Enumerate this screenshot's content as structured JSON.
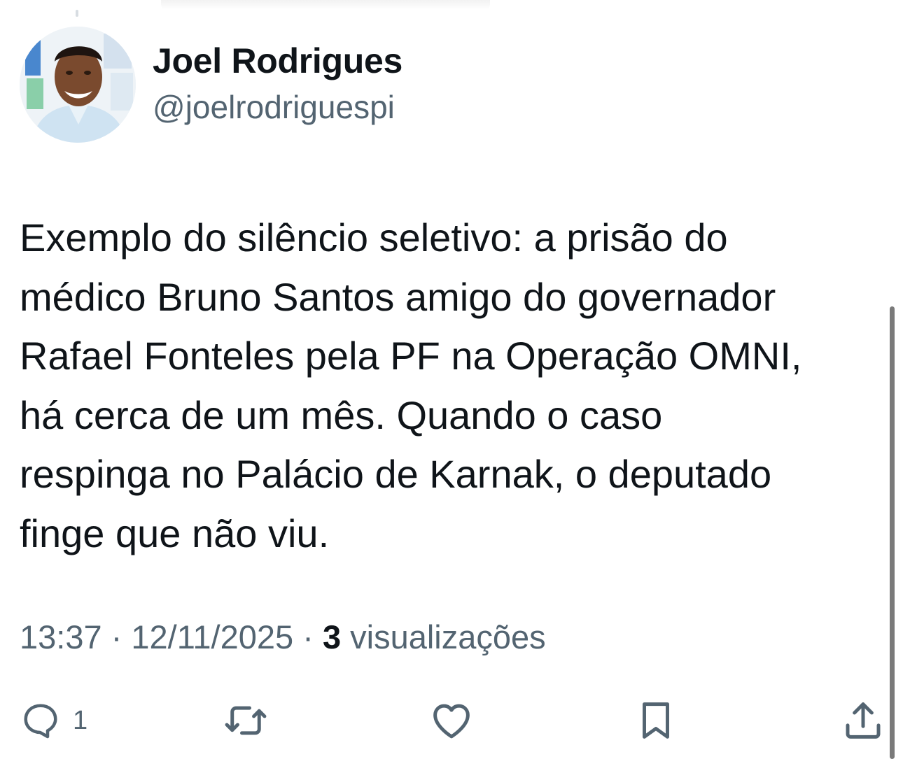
{
  "author": {
    "name": "Joel Rodrigues",
    "handle": "@joelrodriguespi"
  },
  "tweet": {
    "text": "Exemplo do silêncio seletivo: a prisão do\nmédico Bruno Santos amigo do governador\nRafael Fonteles pela PF na Operação OMNI,\nhá cerca de um mês. Quando o caso\nrespinga no Palácio de Karnak, o deputado\nfinge que não viu.",
    "time": "13:37",
    "separator": " · ",
    "date": "12/11/2025",
    "view_count": "3",
    "views_label": " visualizações"
  },
  "actions": {
    "reply_count": "1",
    "icons": [
      "reply-icon",
      "retweet-icon",
      "like-icon",
      "bookmark-icon",
      "share-icon"
    ]
  },
  "colors": {
    "text_primary": "#0f1419",
    "text_secondary": "#536471",
    "background": "#ffffff"
  }
}
